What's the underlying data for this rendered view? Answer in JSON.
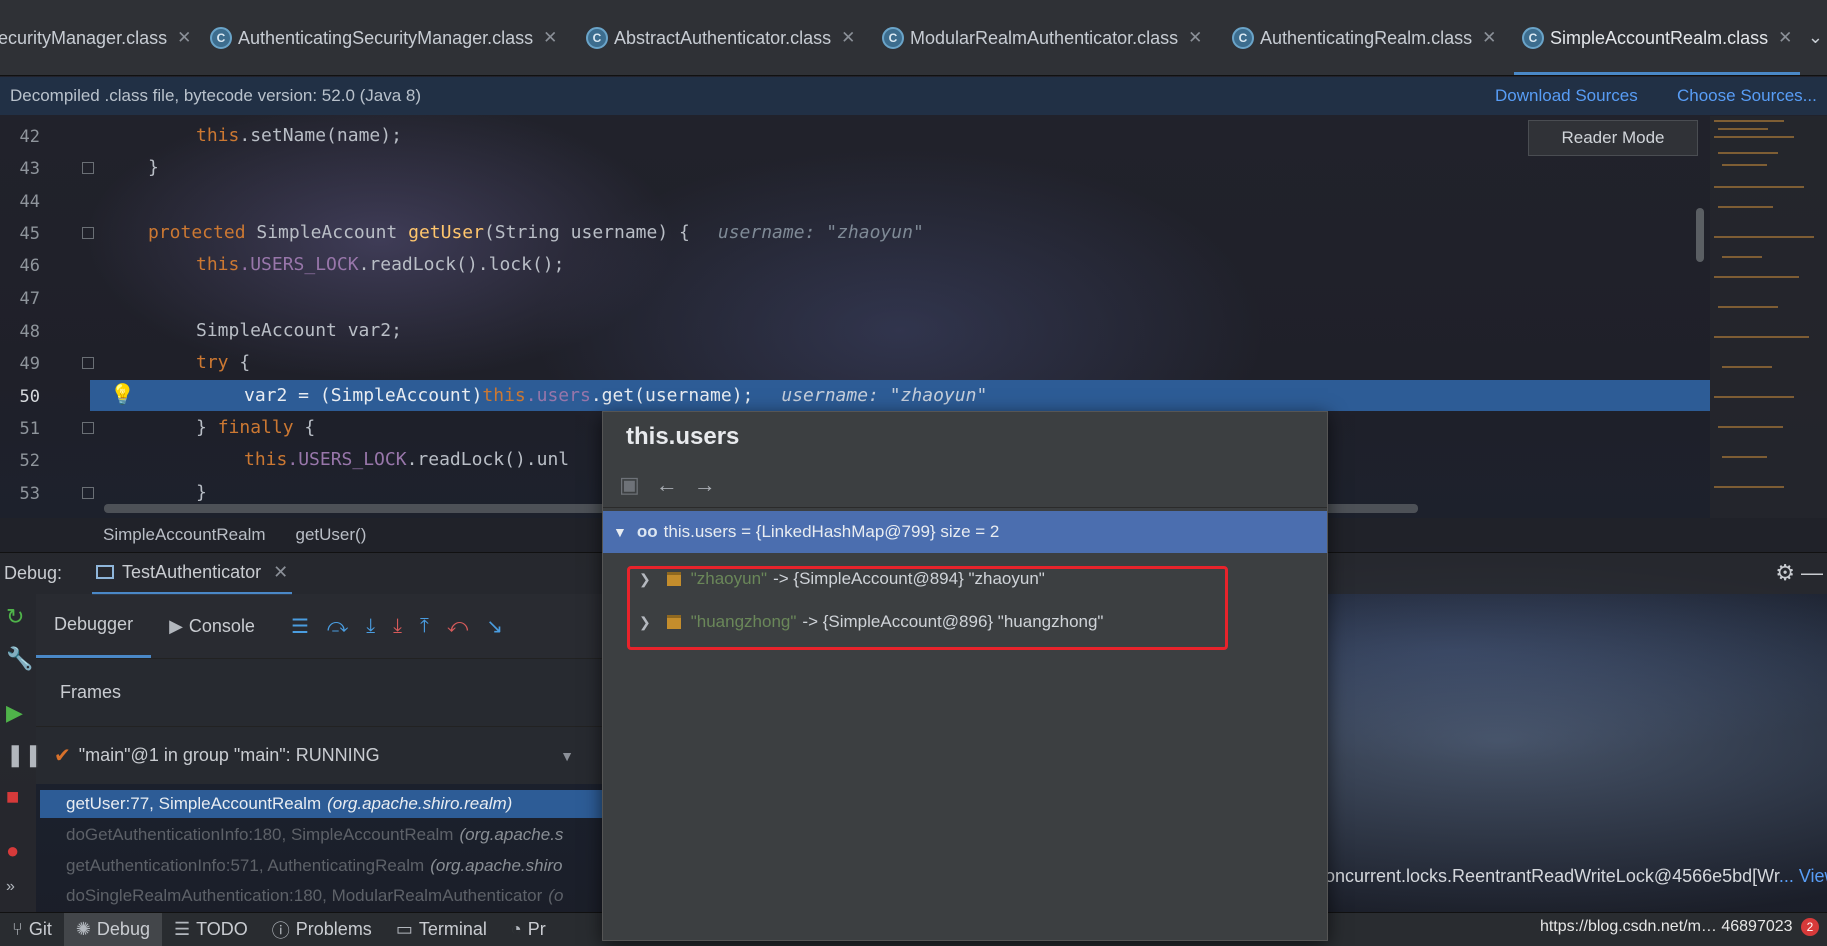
{
  "tabs": [
    {
      "label": "ecurityManager.class",
      "active": false
    },
    {
      "label": "AuthenticatingSecurityManager.class",
      "active": false
    },
    {
      "label": "AbstractAuthenticator.class",
      "active": false
    },
    {
      "label": "ModularRealmAuthenticator.class",
      "active": false
    },
    {
      "label": "AuthenticatingRealm.class",
      "active": false
    },
    {
      "label": "SimpleAccountRealm.class",
      "active": true
    }
  ],
  "banner": {
    "message": "Decompiled .class file, bytecode version: 52.0 (Java 8)",
    "download_sources": "Download Sources",
    "choose_sources": "Choose Sources..."
  },
  "editor": {
    "reader_mode": "Reader Mode",
    "line_numbers": [
      "42",
      "43",
      "44",
      "45",
      "46",
      "47",
      "48",
      "49",
      "50",
      "51",
      "52",
      "53"
    ],
    "lines": {
      "l42_this": "this",
      "l42_rest": ".setName(name);",
      "l43": "}",
      "l45_protected": "protected",
      "l45_type": " SimpleAccount ",
      "l45_fn": "getUser",
      "l45_rest": "(String username) {",
      "l45_hint": "username: \"zhaoyun\"",
      "l46_this": "this",
      "l46_field": ".USERS_LOCK",
      "l46_rest": ".readLock().lock();",
      "l48": "SimpleAccount var2;",
      "l49_try": "try",
      "l49_rest": " {",
      "l50_code": "var2 = (SimpleAccount)",
      "l50_this": "this",
      "l50_field": ".users",
      "l50_rest": ".get(username);",
      "l50_hint": "username: \"zhaoyun\"",
      "l51_open": "} ",
      "l51_finally": "finally",
      "l51_rest": " {",
      "l52_this": "this",
      "l52_field": ".USERS_LOCK",
      "l52_rest": ".readLock().unl",
      "l53": "}"
    }
  },
  "breadcrumb": {
    "class": "SimpleAccountRealm",
    "method": "getUser()"
  },
  "debug": {
    "label": "Debug:",
    "run_tab": "TestAuthenticator",
    "tabs": {
      "debugger": "Debugger",
      "console": "Console"
    },
    "frames_header": "Frames",
    "thread": "\"main\"@1 in group \"main\": RUNNING",
    "frames": [
      {
        "method": "getUser:77, SimpleAccountRealm",
        "pkg": "(org.apache.shiro.realm)"
      },
      {
        "method": "doGetAuthenticationInfo:180, SimpleAccountRealm",
        "pkg": "(org.apache.s"
      },
      {
        "method": "getAuthenticationInfo:571, AuthenticatingRealm",
        "pkg": "(org.apache.shiro"
      },
      {
        "method": "doSingleRealmAuthentication:180, ModularRealmAuthenticator",
        "pkg": "(o"
      }
    ],
    "variable_tail": "oncurrent.locks.ReentrantReadWriteLock@4566e5bd[Wr",
    "variable_tail_view": "... View"
  },
  "statusbar": {
    "items": [
      "Git",
      "Debug",
      "TODO",
      "Problems",
      "Terminal",
      "Pr"
    ],
    "url": "https://blog.csdn.net/m… 46897023",
    "event_count": "2"
  },
  "popup": {
    "title": "this.users",
    "root": "this.users = {LinkedHashMap@799}  size = 2",
    "entries": [
      {
        "key": "\"zhaoyun\"",
        "value": "-> {SimpleAccount@894} \"zhaoyun\""
      },
      {
        "key": "\"huangzhong\"",
        "value": "-> {SimpleAccount@896} \"huangzhong\""
      }
    ]
  },
  "colors": {
    "accent": "#4a88c7",
    "selection": "#2d5c96",
    "highlight_box": "#e8232b",
    "keyword": "#cc7832",
    "method": "#ffc66d",
    "field": "#9876aa",
    "string": "#6a8759"
  }
}
